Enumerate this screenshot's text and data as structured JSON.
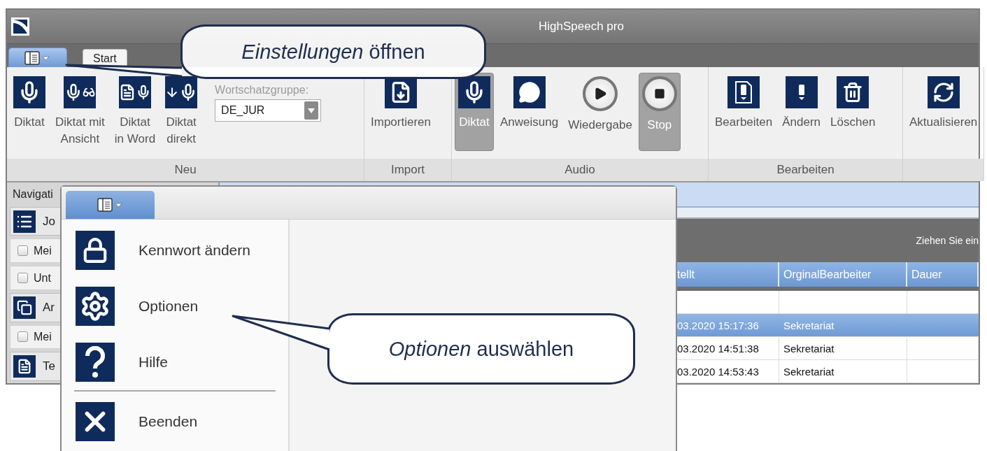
{
  "window": {
    "title": "HighSpeech pro"
  },
  "app_menu_button": {
    "open": true
  },
  "tabs": [
    {
      "label": "Start",
      "selected": false
    }
  ],
  "ribbon": {
    "groups": [
      {
        "label": "Neu",
        "buttons": [
          {
            "label": "Diktat",
            "pressed": false
          },
          {
            "label": "Diktat mit\nAnsicht",
            "pressed": false
          },
          {
            "label": "Diktat\nin Word",
            "pressed": false
          },
          {
            "label": "Diktat\ndirekt",
            "pressed": false
          }
        ],
        "vocabulary": {
          "label": "Wortschatzgruppe:",
          "value": "DE_JUR"
        }
      },
      {
        "label": "Import",
        "buttons": [
          {
            "label": "Importieren",
            "pressed": false
          }
        ]
      },
      {
        "label": "Audio",
        "buttons": [
          {
            "label": "Diktat",
            "pressed": true
          },
          {
            "label": "Anweisung",
            "pressed": false
          },
          {
            "label": "Wiedergabe",
            "pressed": false
          },
          {
            "label": "Stop",
            "pressed": true
          }
        ]
      },
      {
        "label": "Bearbeiten",
        "buttons": [
          {
            "label": "Bearbeiten",
            "pressed": false
          },
          {
            "label": "Ändern",
            "pressed": false
          },
          {
            "label": "Löschen",
            "pressed": false
          }
        ]
      },
      {
        "buttons": [
          {
            "label": "Aktualisieren",
            "pressed": false
          }
        ]
      }
    ]
  },
  "nav": {
    "title": "Navigati",
    "sections": [
      {
        "label": "Jo",
        "items": [
          {
            "label": "Mei",
            "checked": false
          },
          {
            "label": "Unt",
            "checked": false
          }
        ]
      },
      {
        "label": "Ar",
        "items": [
          {
            "label": "Mei",
            "checked": false
          }
        ]
      },
      {
        "label": "Te"
      }
    ]
  },
  "table": {
    "group_hint": "Ziehen Sie ein",
    "columns": [
      "tellt",
      "OrginalBearbeiter",
      "Dauer"
    ],
    "rows": [
      {
        "selected": false
      },
      {
        "selected": true,
        "cells": [
          "03.2020 15:17:36",
          "Sekretariat"
        ]
      },
      {
        "selected": false,
        "cells": [
          "03.2020 14:51:38",
          "Sekretariat"
        ]
      },
      {
        "selected": false,
        "cells": [
          "03.2020 14:53:43",
          "Sekretariat"
        ]
      }
    ]
  },
  "menu": {
    "items": [
      {
        "kind": "item",
        "label": "Kennwort ändern"
      },
      {
        "kind": "item",
        "label": "Optionen"
      },
      {
        "kind": "item",
        "label": "Hilfe"
      },
      {
        "kind": "separator"
      },
      {
        "kind": "item",
        "label": "Beenden"
      }
    ]
  },
  "callouts": [
    {
      "text": "*Einstellungen* öffnen"
    },
    {
      "text": "*Optionen* auswählen"
    }
  ]
}
